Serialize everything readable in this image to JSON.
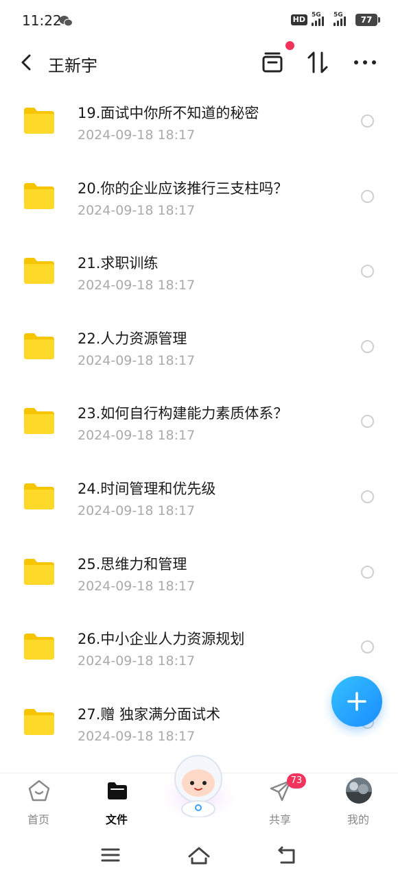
{
  "status_bar": {
    "time": "11:22",
    "hd_label": "HD",
    "signal1_label": "5G",
    "signal2_label": "5G",
    "battery": "77"
  },
  "header": {
    "title": "王新宇"
  },
  "files": [
    {
      "name": "19.面试中你所不知道的秘密",
      "date": "2024-09-18  18:17"
    },
    {
      "name": "20.你的企业应该推行三支柱吗？",
      "date": "2024-09-18  18:17"
    },
    {
      "name": "21.求职训练",
      "date": "2024-09-18  18:17"
    },
    {
      "name": "22.人力资源管理",
      "date": "2024-09-18  18:17"
    },
    {
      "name": "23.如何自行构建能力素质体系？",
      "date": "2024-09-18  18:17"
    },
    {
      "name": "24.时间管理和优先级",
      "date": "2024-09-18  18:17"
    },
    {
      "name": "25.思维力和管理",
      "date": "2024-09-18  18:17"
    },
    {
      "name": "26.中小企业人力资源规划",
      "date": "2024-09-18  18:17"
    },
    {
      "name": "27.赠 独家满分面试术",
      "date": "2024-09-18  18:17"
    }
  ],
  "bottom_nav": {
    "items": [
      {
        "label": "首页",
        "icon": "home-icon"
      },
      {
        "label": "文件",
        "icon": "folder-icon"
      },
      {
        "label": "共享",
        "icon": "share-icon"
      },
      {
        "label": "我的",
        "icon": "avatar"
      }
    ],
    "share_badge": "73"
  },
  "colors": {
    "accent": "#1a8cff",
    "folder": "#ffd21f",
    "badge": "#f2335c"
  }
}
